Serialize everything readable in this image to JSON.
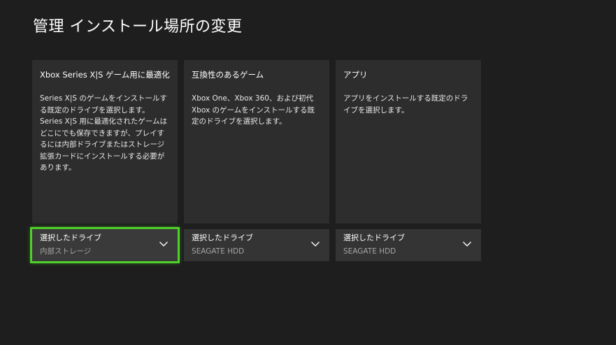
{
  "header": {
    "title": "管理  インストール場所の変更"
  },
  "columns": [
    {
      "heading": "Xbox Series X|S ゲーム用に最適化",
      "description": "Series X|S のゲームをインストールする既定のドライブを選択します。Series X|S 用に最適化されたゲームはどこにでも保存できますが、プレイするには内部ドライブまたはストレージ拡張カードにインストールする必要があります。",
      "selector": {
        "label": "選択したドライブ",
        "value": "内部ストレージ",
        "icon": "chevron-down-icon",
        "focused": true
      }
    },
    {
      "heading": "互換性のあるゲーム",
      "description": "Xbox One、Xbox 360、および初代 Xbox のゲームをインストールする既定のドライブを選択します。",
      "selector": {
        "label": "選択したドライブ",
        "value": "SEAGATE HDD",
        "icon": "chevron-down-icon",
        "focused": false
      }
    },
    {
      "heading": "アプリ",
      "description": "アプリをインストールする既定のドライブを選択します。",
      "selector": {
        "label": "選択したドライブ",
        "value": "SEAGATE HDD",
        "icon": "chevron-down-icon",
        "focused": false
      }
    }
  ],
  "colors": {
    "background": "#1e1e1e",
    "card": "#2d2d2d",
    "selector": "#343434",
    "focus_accent": "#4ed12a",
    "secondary_text": "#a6a6a6"
  }
}
